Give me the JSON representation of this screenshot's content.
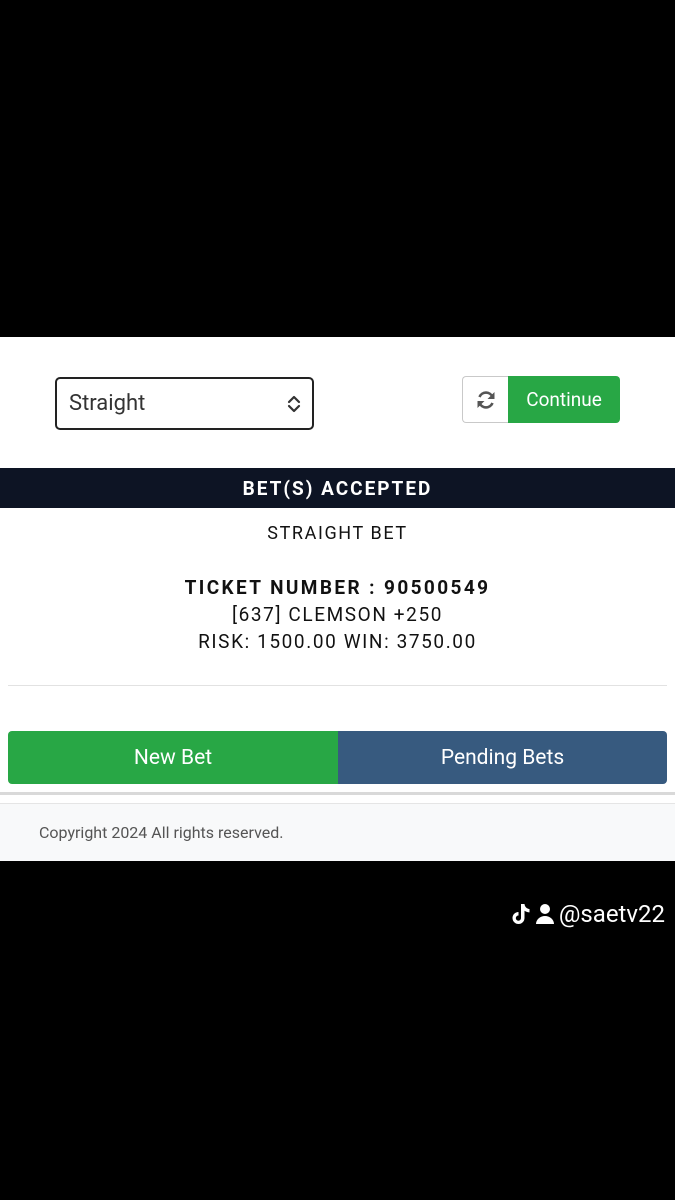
{
  "bet_form": {
    "bet_type_selected": "Straight",
    "continue_label": "Continue"
  },
  "confirmation": {
    "header": "BET(S) ACCEPTED",
    "bet_type": "STRAIGHT BET",
    "ticket_line": "TICKET NUMBER : 90500549",
    "selection": "[637] CLEMSON +250",
    "risk_win": "RISK: 1500.00 WIN: 3750.00"
  },
  "actions": {
    "new_bet_label": "New Bet",
    "pending_bets_label": "Pending Bets"
  },
  "footer": {
    "copyright": "Copyright 2024 All rights reserved."
  },
  "watermark": {
    "handle": "@saetv22",
    "icons": [
      "tiktok-icon",
      "user-icon"
    ]
  },
  "colors": {
    "green": "#28a745",
    "blue": "#375a7f",
    "navy": "#0d1424"
  }
}
